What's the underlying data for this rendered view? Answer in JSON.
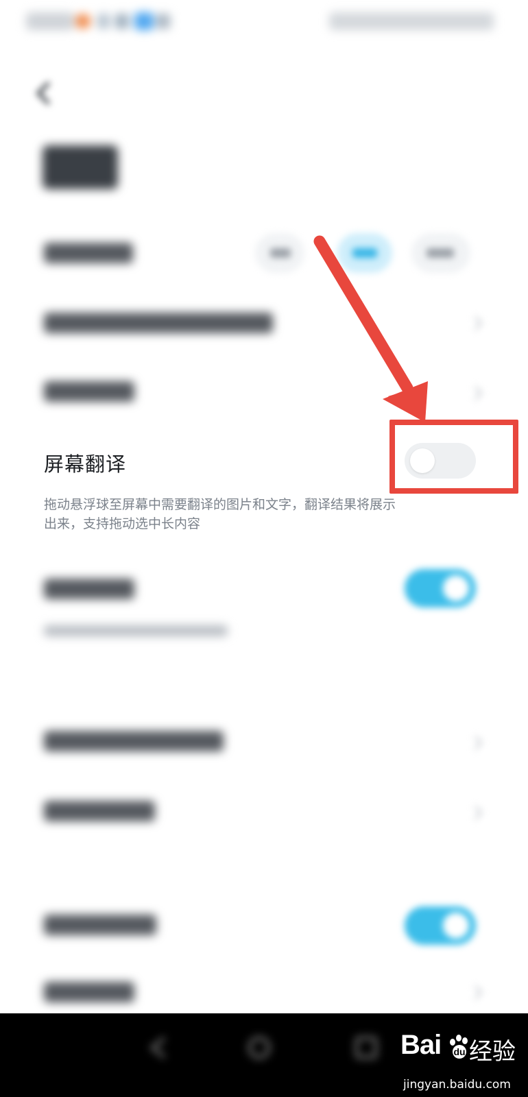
{
  "screen_translate": {
    "label": "屏幕翻译",
    "description": "拖动悬浮球至屏幕中需要翻译的图片和文字，翻译结果将展示出来，支持拖动选中长内容",
    "enabled": false
  },
  "watermark": {
    "logo": "Bai",
    "logo_cn": "经验",
    "url": "jingyan.baidu.com"
  },
  "colors": {
    "highlight": "#e8473d",
    "toggle_on": "#3bbde9",
    "toggle_off": "#eef0f2"
  }
}
